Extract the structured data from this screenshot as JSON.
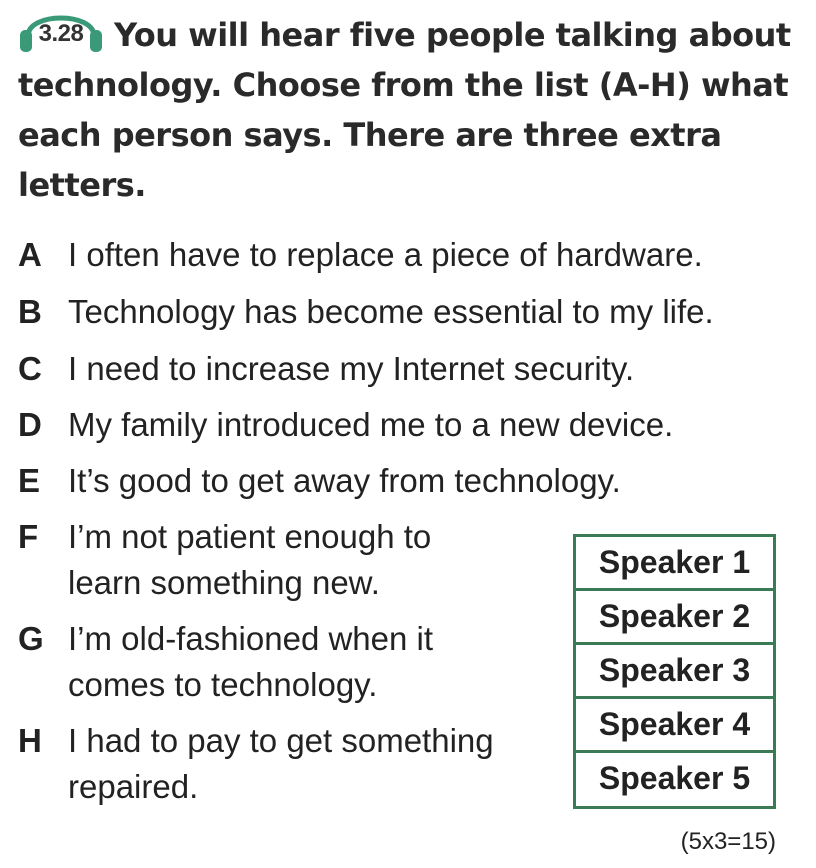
{
  "exercise": {
    "track": "3.28",
    "instruction": "You will hear five people talking about technology. Choose from the list (A-H) what each person says. There are three extra letters."
  },
  "options": [
    {
      "letter": "A",
      "lines": [
        "I often have to replace a piece of hardware."
      ]
    },
    {
      "letter": "B",
      "lines": [
        "Technology has become essential to my life."
      ]
    },
    {
      "letter": "C",
      "lines": [
        "I need to increase my Internet security."
      ]
    },
    {
      "letter": "D",
      "lines": [
        "My family introduced me to a new device."
      ]
    },
    {
      "letter": "E",
      "lines": [
        "It’s good to get away from technology."
      ]
    },
    {
      "letter": "F",
      "lines": [
        "I’m not patient enough to",
        "learn something new."
      ]
    },
    {
      "letter": "G",
      "lines": [
        "I’m old-fashioned when it",
        "comes to technology."
      ]
    },
    {
      "letter": "H",
      "lines": [
        "I had to pay to get something",
        "repaired."
      ]
    }
  ],
  "speakers": [
    "Speaker 1",
    "Speaker 2",
    "Speaker 3",
    "Speaker 4",
    "Speaker 5"
  ],
  "score": "(5x3=15)",
  "colors": {
    "headphones": "#3a9a78",
    "table_border": "#3a7a55"
  },
  "icons": {
    "audio": "headphones-icon"
  }
}
